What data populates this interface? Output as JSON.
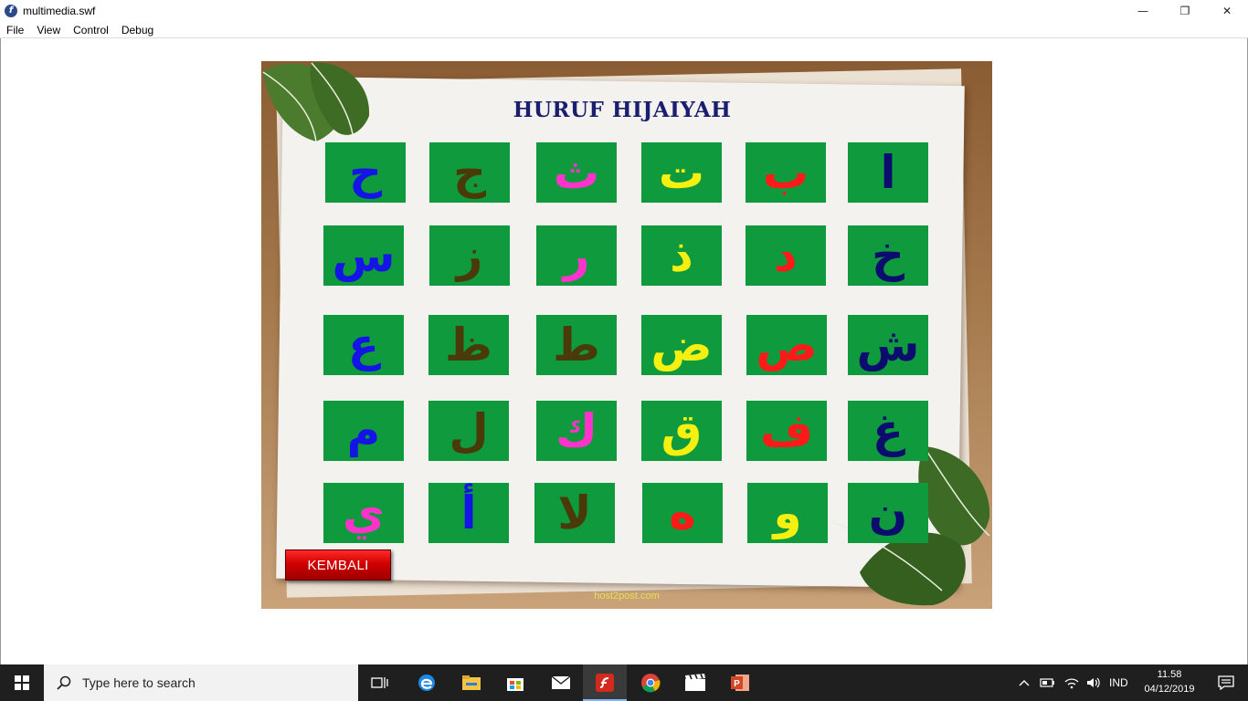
{
  "window": {
    "title": "multimedia.swf",
    "minimize_glyph": "—",
    "restore_glyph": "❐",
    "close_glyph": "✕"
  },
  "menu": [
    "File",
    "View",
    "Control",
    "Debug"
  ],
  "stage": {
    "title": "HURUF HIJAIYAH",
    "back_button": "KEMBALI",
    "footer": "host2post.com",
    "tile_color": "#0f9a3d"
  },
  "letters": [
    {
      "char": "ح",
      "color": "#1414e6"
    },
    {
      "char": "ج",
      "color": "#4a3a0a"
    },
    {
      "char": "ث",
      "color": "#ff33cc"
    },
    {
      "char": "ت",
      "color": "#f5f010"
    },
    {
      "char": "ب",
      "color": "#ff1a1a"
    },
    {
      "char": "ا",
      "color": "#0c0c6e"
    },
    {
      "char": "س",
      "color": "#1414e6"
    },
    {
      "char": "ز",
      "color": "#4a3a0a"
    },
    {
      "char": "ر",
      "color": "#ff33cc"
    },
    {
      "char": "ذ",
      "color": "#f5f010"
    },
    {
      "char": "د",
      "color": "#ff1a1a"
    },
    {
      "char": "خ",
      "color": "#0c0c6e"
    },
    {
      "char": "ع",
      "color": "#1414e6"
    },
    {
      "char": "ظ",
      "color": "#4a3a0a"
    },
    {
      "char": "ط",
      "color": "#4a3a0a"
    },
    {
      "char": "ض",
      "color": "#f5f010"
    },
    {
      "char": "ص",
      "color": "#ff1a1a"
    },
    {
      "char": "ش",
      "color": "#0c0c6e"
    },
    {
      "char": "م",
      "color": "#1414e6"
    },
    {
      "char": "ل",
      "color": "#4a3a0a"
    },
    {
      "char": "ك",
      "color": "#ff33cc"
    },
    {
      "char": "ق",
      "color": "#f5f010"
    },
    {
      "char": "ف",
      "color": "#ff1a1a"
    },
    {
      "char": "غ",
      "color": "#0c0c6e"
    },
    {
      "char": "ي",
      "color": "#ff33cc"
    },
    {
      "char": "أ",
      "color": "#1414e6"
    },
    {
      "char": "لا",
      "color": "#4a3a0a"
    },
    {
      "char": "ه",
      "color": "#ff1a1a"
    },
    {
      "char": "و",
      "color": "#f5f010"
    },
    {
      "char": "ن",
      "color": "#0c0c6e"
    }
  ],
  "taskbar": {
    "search_placeholder": "Type here to search",
    "language": "IND",
    "time": "11.58",
    "date": "04/12/2019",
    "apps": [
      "task-view-icon",
      "edge-icon",
      "file-explorer-icon",
      "store-icon",
      "mail-icon",
      "flash-player-icon",
      "chrome-icon",
      "movie-maker-icon",
      "powerpoint-icon"
    ]
  }
}
